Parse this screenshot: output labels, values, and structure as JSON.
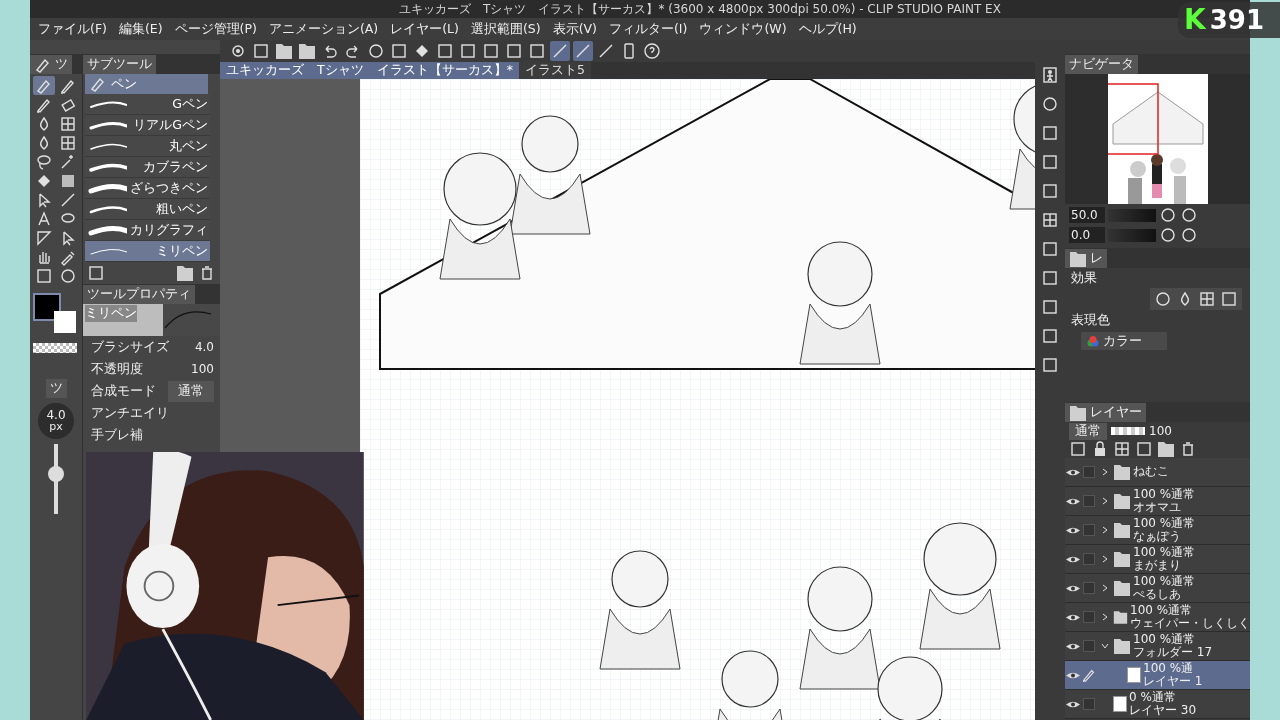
{
  "window": {
    "title": "ユキッカーズ　Tシャツ　イラスト【サーカス】* (3600 x 4800px 300dpi 50.0%)  - CLIP STUDIO PAINT EX"
  },
  "stream_badge": {
    "logo": "K",
    "count": "391"
  },
  "menu": [
    "ファイル(F)",
    "編集(E)",
    "ページ管理(P)",
    "アニメーション(A)",
    "レイヤー(L)",
    "選択範囲(S)",
    "表示(V)",
    "フィルター(I)",
    "ウィンドウ(W)",
    "ヘルプ(H)"
  ],
  "toolbar": [
    {
      "on": false
    },
    {
      "on": false
    },
    {
      "on": false
    },
    {
      "on": false
    },
    {
      "on": false
    },
    {
      "on": false
    },
    {
      "on": false
    },
    {
      "on": false
    },
    {
      "on": false
    },
    {
      "on": false
    },
    {
      "on": false
    },
    {
      "on": false
    },
    {
      "on": false
    },
    {
      "on": false
    },
    {
      "on": true
    },
    {
      "on": true
    },
    {
      "on": false
    },
    {
      "on": false
    },
    {
      "on": false
    }
  ],
  "document_tabs": [
    {
      "label": "ユキッカーズ　Tシャツ　イラスト【サーカス】*",
      "selected": true
    },
    {
      "label": "イラスト5",
      "selected": false
    }
  ],
  "tool_palette": {
    "tab": "ツ",
    "tools": [
      {
        "selected": true
      },
      {
        "selected": false
      },
      {
        "selected": false
      },
      {
        "selected": false
      },
      {
        "selected": false
      },
      {
        "selected": false
      },
      {
        "selected": false
      },
      {
        "selected": false
      },
      {
        "selected": false
      },
      {
        "selected": false
      },
      {
        "selected": false
      },
      {
        "selected": false
      },
      {
        "selected": false
      },
      {
        "selected": false
      },
      {
        "selected": false
      },
      {
        "selected": false
      },
      {
        "selected": false
      },
      {
        "selected": false
      },
      {
        "selected": false
      },
      {
        "selected": false
      },
      {
        "selected": false
      },
      {
        "selected": false
      }
    ]
  },
  "subtool_palette": {
    "tab": "サブツール",
    "group": "ペン",
    "items": [
      {
        "label": "Gペン",
        "selected": false
      },
      {
        "label": "リアルGペン",
        "selected": false
      },
      {
        "label": "丸ペン",
        "selected": false
      },
      {
        "label": "カブラペン",
        "selected": false
      },
      {
        "label": "ざらつきペン",
        "selected": false
      },
      {
        "label": "粗いペン",
        "selected": false
      },
      {
        "label": "カリグラフィ",
        "selected": false
      },
      {
        "label": "ミリペン",
        "selected": true
      }
    ]
  },
  "tool_property": {
    "tab": "ツールプロパティ",
    "brush_name": "ミリペン",
    "rows": [
      {
        "kind": "number",
        "label": "ブラシサイズ",
        "value": "4.0"
      },
      {
        "kind": "number",
        "label": "不透明度",
        "value": "100"
      },
      {
        "kind": "select",
        "label": "合成モード",
        "value": "通常"
      },
      {
        "kind": "label",
        "label": "アンチエイリ"
      },
      {
        "kind": "label",
        "label": "手ブレ補"
      }
    ]
  },
  "brush_size_panel": {
    "tab": "ツ",
    "size": "4.0",
    "unit": "px",
    "level": 0.6
  },
  "navigator": {
    "tab": "ナビゲータ",
    "zoom": "50.0",
    "angle": "0.0"
  },
  "layer_property": {
    "tab": "レ",
    "effect_label": "効果",
    "color_label": "表現色",
    "color_mode": "カラー"
  },
  "layers": {
    "tab": "レイヤー",
    "blend_mode": "通常",
    "opacity": "100",
    "items": [
      {
        "kind": "folder",
        "name": "ねむこ",
        "visible": true,
        "expanded": false,
        "selected": false
      },
      {
        "kind": "folder",
        "mode": "100 %通常",
        "name": "オオマユ",
        "visible": true,
        "expanded": false,
        "selected": false
      },
      {
        "kind": "folder",
        "mode": "100 %通常",
        "name": "なぁぽう",
        "visible": true,
        "expanded": false,
        "selected": false
      },
      {
        "kind": "folder",
        "mode": "100 %通常",
        "name": "まがまり",
        "visible": true,
        "expanded": false,
        "selected": false
      },
      {
        "kind": "folder",
        "mode": "100 %通常",
        "name": "ぺるしあ",
        "visible": true,
        "expanded": false,
        "selected": false
      },
      {
        "kind": "folder",
        "mode": "100 %通常",
        "name": "ウェイパー・しくしく",
        "visible": true,
        "expanded": false,
        "selected": false
      },
      {
        "kind": "folder",
        "mode": "100 %通常",
        "name": "フォルダー 17",
        "visible": true,
        "expanded": true,
        "selected": false,
        "children": [
          {
            "kind": "raster",
            "mode": "100 %通",
            "name": "レイヤー 1",
            "visible": true,
            "selected": true
          }
        ]
      },
      {
        "kind": "raster",
        "mode": "0 %通常",
        "name": "レイヤー 30",
        "visible": true,
        "selected": false
      }
    ]
  }
}
